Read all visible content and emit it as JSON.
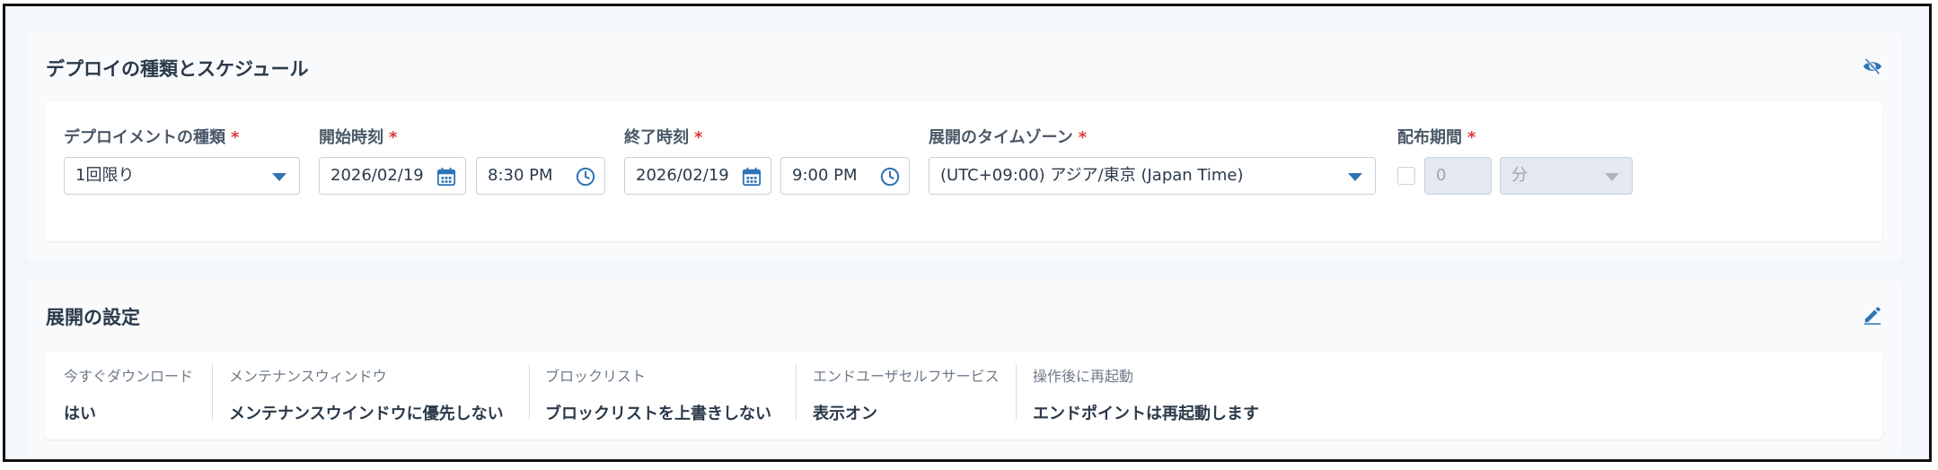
{
  "schedule": {
    "title": "デプロイの種類とスケジュール",
    "deploy_type": {
      "label": "デプロイメントの種類",
      "required": "*",
      "value": "1回限り"
    },
    "start": {
      "label": "開始時刻",
      "required": "*",
      "date": "2026/02/19",
      "time": "8:30 PM"
    },
    "end": {
      "label": "終了時刻",
      "required": "*",
      "date": "2026/02/19",
      "time": "9:00 PM"
    },
    "timezone": {
      "label": "展開のタイムゾーン",
      "required": "*",
      "value": "(UTC+09:00) アジア/東京 (Japan Time)"
    },
    "duration": {
      "label": "配布期間",
      "required": "*",
      "value": "0",
      "unit": "分"
    }
  },
  "deployment_settings": {
    "title": "展開の設定",
    "items": [
      {
        "label": "今すぐダウンロード",
        "value": "はい"
      },
      {
        "label": "メンテナンスウィンドウ",
        "value": "メンテナンスウインドウに優先しない"
      },
      {
        "label": "ブロックリスト",
        "value": "ブロックリストを上書きしない"
      },
      {
        "label": "エンドユーザセルフサービス",
        "value": "表示オン"
      },
      {
        "label": "操作後に再起動",
        "value": "エンドポイントは再起動します"
      }
    ]
  },
  "colors": {
    "accent": "#2f74b5",
    "required": "#d93a3a",
    "background": "#f3f6fa"
  },
  "icons": [
    "eye-slash-icon",
    "calendar-icon",
    "clock-icon",
    "chevron-down-icon",
    "pencil-icon"
  ]
}
